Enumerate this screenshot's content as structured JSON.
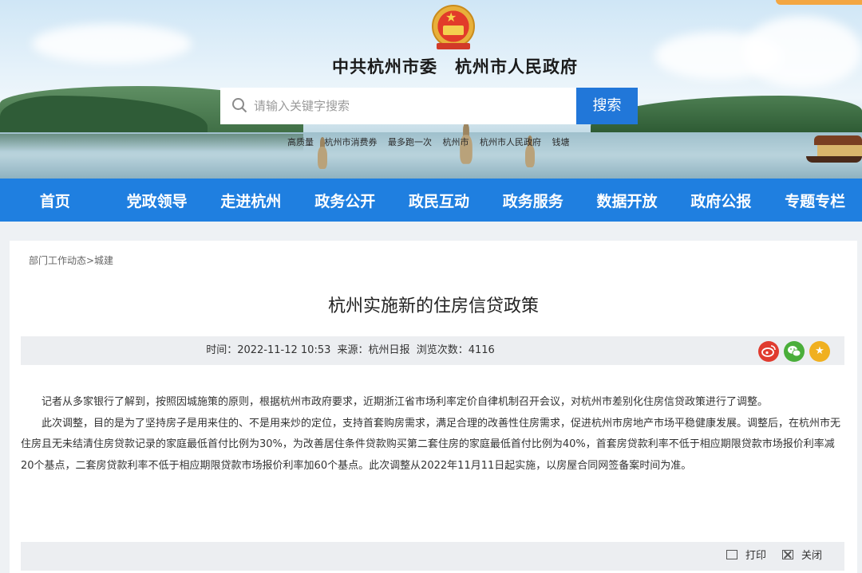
{
  "header": {
    "site_title": "中共杭州市委　杭州市人民政府",
    "search_placeholder": "请输入关键字搜索",
    "search_button": "搜索",
    "hot_words": [
      "高质量",
      "杭州市消费券",
      "最多跑一次",
      "杭州市",
      "杭州市人民政府",
      "钱塘"
    ]
  },
  "nav": {
    "items": [
      "首页",
      "党政领导",
      "走进杭州",
      "政务公开",
      "政民互动",
      "政务服务",
      "数据开放",
      "政府公报",
      "专题专栏"
    ]
  },
  "article": {
    "breadcrumb": "部门工作动态>城建",
    "title": "杭州实施新的住房信贷政策",
    "meta": {
      "time_label": "时间：",
      "time": "2022-11-12 10:53",
      "source_label": "来源：",
      "source": "杭州日报",
      "views_label": "浏览次数：",
      "views": "4116"
    },
    "paragraphs": [
      "记者从多家银行了解到，按照因城施策的原则，根据杭州市政府要求，近期浙江省市场利率定价自律机制召开会议，对杭州市差别化住房信贷政策进行了调整。",
      "此次调整，目的是为了坚持房子是用来住的、不是用来炒的定位，支持首套购房需求，满足合理的改善性住房需求，促进杭州市房地产市场平稳健康发展。调整后，在杭州市无住房且无未结清住房贷款记录的家庭最低首付比例为30%，为改善居住条件贷款购买第二套住房的家庭最低首付比例为40%，首套房贷款利率不低于相应期限贷款市场报价利率减20个基点，二套房贷款利率不低于相应期限贷款市场报价利率加60个基点。此次调整从2022年11月11日起实施，以房屋合同网签备案时间为准。"
    ],
    "share_icons": [
      "weibo-icon",
      "wechat-icon",
      "favorite-icon"
    ],
    "tools": {
      "print": "打印",
      "close": "关闭"
    }
  },
  "colors": {
    "nav_blue": "#1f7fe0",
    "search_blue": "#2177d9",
    "weibo_red": "#e03b2f",
    "wechat_green": "#4aae3a",
    "favorite_gold": "#f0b020"
  }
}
